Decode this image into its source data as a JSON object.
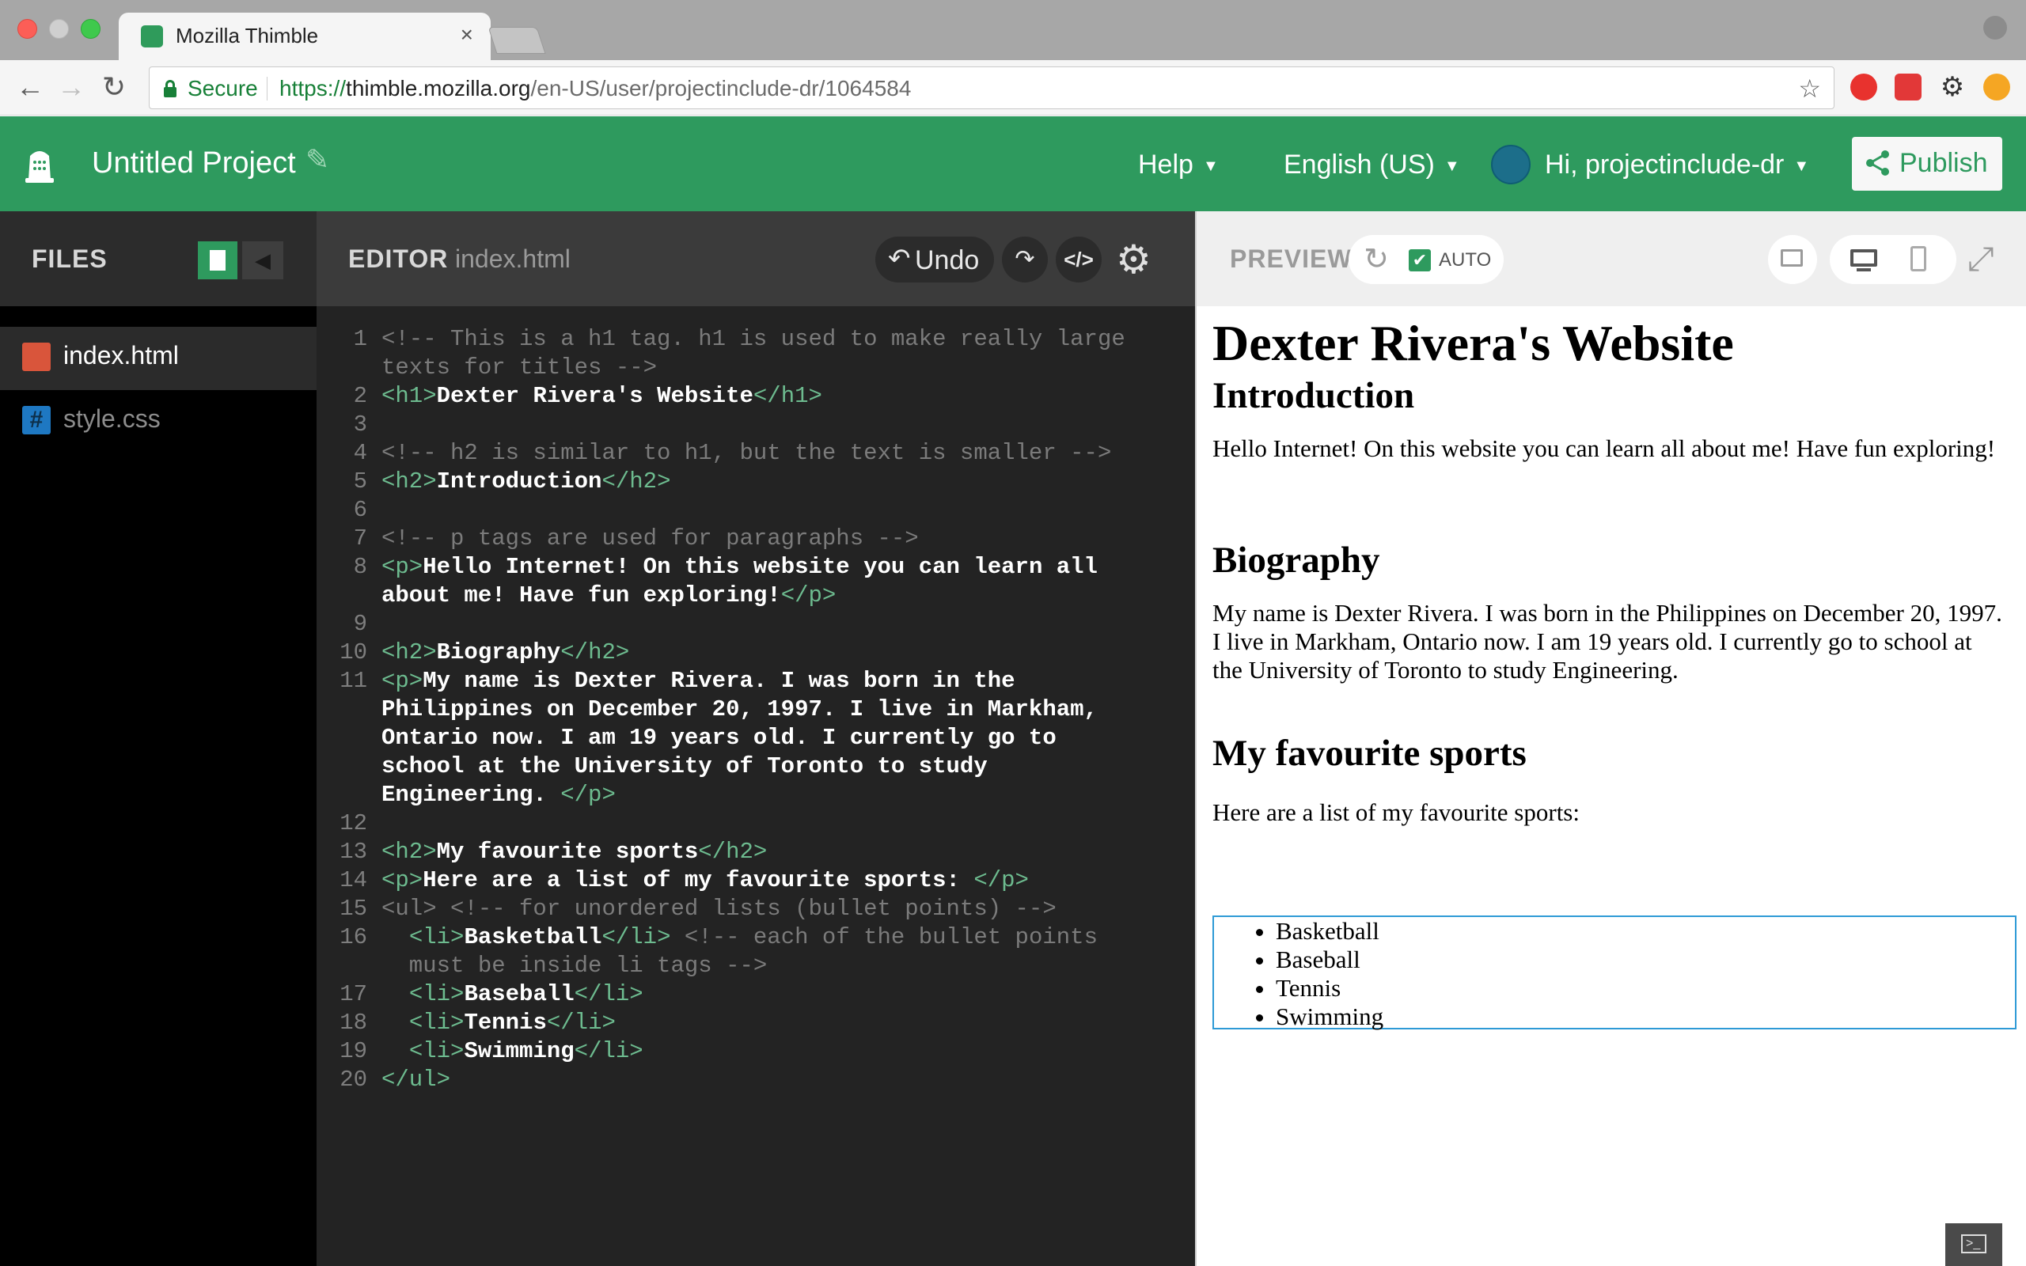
{
  "browser": {
    "tab_title": "Mozilla Thimble",
    "tab_close": "×",
    "secure_label": "Secure",
    "url_scheme": "https://",
    "url_host": "thimble.mozilla.org",
    "url_path": "/en-US/user/projectinclude-dr/1064584",
    "nav": {
      "back": "←",
      "forward": "→",
      "reload": "↻"
    },
    "star": "☆"
  },
  "header": {
    "project_title": "Untitled Project",
    "help_label": "Help",
    "language_label": "English (US)",
    "user_label": "Hi, projectinclude-dr",
    "publish_label": "Publish"
  },
  "files": {
    "title": "FILES",
    "items": [
      {
        "name": "index.html",
        "active": true
      },
      {
        "name": "style.css",
        "active": false
      }
    ]
  },
  "editor": {
    "title": "EDITOR",
    "filename": "index.html",
    "undo_label": "Undo",
    "code_toggle": "</>",
    "line_numbers": [
      "1",
      "",
      "2",
      "3",
      "4",
      "5",
      "6",
      "7",
      "8",
      "",
      "9",
      "10",
      "11",
      "",
      "",
      "",
      "",
      "12",
      "13",
      "14",
      "15",
      "16",
      "",
      "17",
      "18",
      "19",
      "20"
    ],
    "lines": [
      "<!-- This is a h1 tag. h1 is used to make really large",
      "texts for titles -->",
      "<h1>Dexter Rivera's Website</h1>",
      "",
      "<!-- h2 is similar to h1, but the text is smaller -->",
      "<h2>Introduction</h2>",
      "",
      "<!-- p tags are used for paragraphs -->",
      "<p>Hello Internet! On this website you can learn all",
      "about me! Have fun exploring!</p>",
      "",
      "<h2>Biography</h2>",
      "<p>My name is Dexter Rivera. I was born in the",
      "Philippines on December 20, 1997. I live in Markham,",
      "Ontario now. I am 19 years old. I currently go to",
      "school at the University of Toronto to study",
      "Engineering. </p>",
      "",
      "<h2>My favourite sports</h2>",
      "<p>Here are a list of my favourite sports: </p>",
      "<ul> <!-- for unordered lists (bullet points) -->",
      "  <li>Basketball</li> <!-- each of the bullet points",
      "  must be inside li tags -->",
      "  <li>Baseball</li>",
      "  <li>Tennis</li>",
      "  <li>Swimming</li>",
      "</ul>"
    ]
  },
  "preview": {
    "title": "PREVIEW",
    "auto_label": "AUTO",
    "auto_checked": true,
    "page": {
      "h1": "Dexter Rivera's Website",
      "h2_intro": "Introduction",
      "p_intro": "Hello Internet! On this website you can learn all about me! Have fun exploring!",
      "h2_bio": "Biography",
      "p_bio": "My name is Dexter Rivera. I was born in the Philippines on December 20, 1997. I live in Markham, Ontario now. I am 19 years old. I currently go to school at the University of Toronto to study Engineering.",
      "h2_sports": "My favourite sports",
      "p_sports": "Here are a list of my favourite sports:",
      "sports": [
        "Basketball",
        "Baseball",
        "Tennis",
        "Swimming"
      ]
    }
  },
  "colors": {
    "brand_green": "#2e9a5e",
    "editor_bg": "#232323",
    "tag": "#6dbb8f",
    "comment": "#7b7b7b",
    "highlight_outline": "#2e9ad6"
  }
}
